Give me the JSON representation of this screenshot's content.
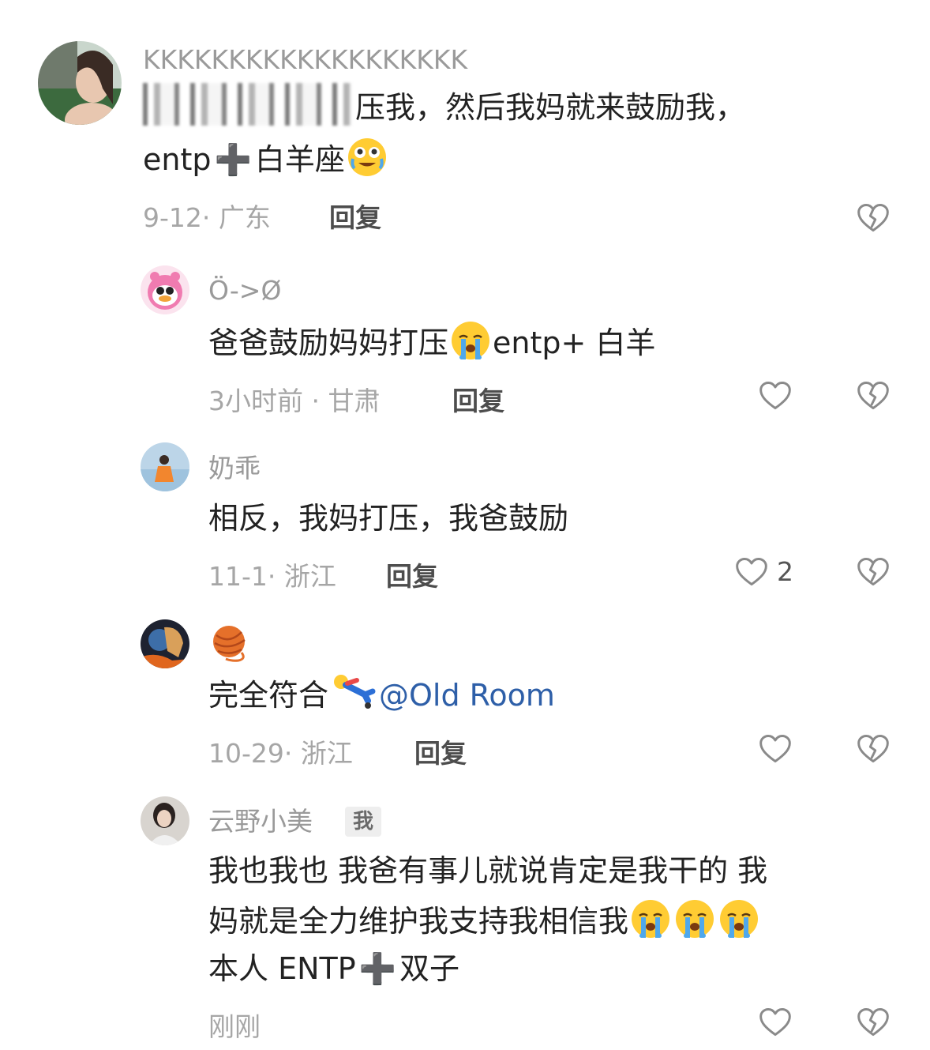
{
  "comments": [
    {
      "username": "KKKKKKKKKKKKKKKKKKK",
      "line1_visible": "压我，然后我妈就来鼓励我，",
      "line2_pre": "entp",
      "line2_plus": "➕",
      "line2_post": "白羊座",
      "emoji": "face-with-tears-of-joy-stars",
      "date": "9-12",
      "location": "广东",
      "reply_label": "回复"
    },
    {
      "username": "Ö->Ø",
      "text_pre": "爸爸鼓励妈妈打压",
      "emoji": "loudly-crying-face",
      "text_post": "entp+ 白羊",
      "date": "3小时前",
      "location": "甘肃",
      "reply_label": "回复"
    },
    {
      "username": "奶乖",
      "text": "相反，我妈打压，我爸鼓励",
      "date": "11-1",
      "location": "浙江",
      "reply_label": "回复",
      "likes": "2"
    },
    {
      "username": "yarn-ball-emoji",
      "text_pre": "完全符合",
      "emoji": "falling-person",
      "mention": "@Old Room",
      "date": "10-29",
      "location": "浙江",
      "reply_label": "回复"
    },
    {
      "username": "云野小美",
      "badge": "我",
      "line1": "我也我也 我爸有事儿就说肯定是我干的 我",
      "line2": "妈就是全力维护我支持我相信我",
      "line3_pre": "本人 ENTP",
      "line3_plus": "➕",
      "line3_post": "双子",
      "emoji": "loudly-crying-face",
      "time": "刚刚"
    }
  ],
  "icons": {
    "like": "heart-outline-icon",
    "dislike": "broken-heart-icon"
  },
  "colors": {
    "mention": "#2e5fa8",
    "meta": "#a6a6a6",
    "username": "#9a9a9a"
  }
}
